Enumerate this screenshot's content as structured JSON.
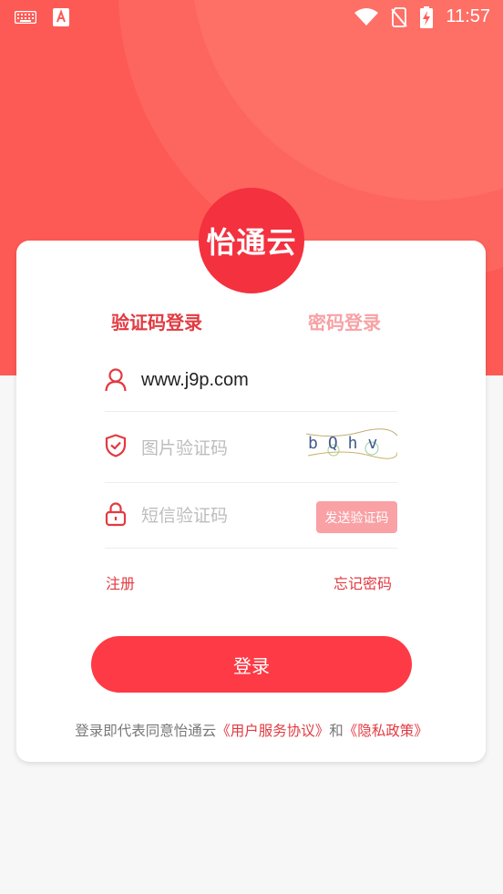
{
  "status_bar": {
    "time": "11:57",
    "icons": [
      "keyboard-icon",
      "app-a-icon",
      "wifi-icon",
      "no-sim-icon",
      "battery-charging-icon"
    ]
  },
  "colors": {
    "hero_bg": "#fe5a55",
    "accent": "#e23a41",
    "button": "#fd3a45",
    "sms_button": "#f9a1a5",
    "inactive_tab": "#f7a1a4"
  },
  "logo": {
    "text": "怡通云"
  },
  "tabs": [
    {
      "label": "验证码登录",
      "active": true
    },
    {
      "label": "密码登录",
      "active": false
    }
  ],
  "form": {
    "username": {
      "icon": "user-icon",
      "value": "www.j9p.com"
    },
    "image_code": {
      "icon": "shield-check-icon",
      "placeholder": "图片验证码",
      "captcha_text": "bQhv"
    },
    "sms_code": {
      "icon": "lock-icon",
      "placeholder": "短信验证码",
      "send_label": "发送验证码"
    }
  },
  "links": {
    "register": "注册",
    "forgot": "忘记密码"
  },
  "login_button": "登录",
  "agreement": {
    "prefix": "登录即代表同意怡通云",
    "terms": "《用户服务协议》",
    "and": "和",
    "privacy": "《隐私政策》"
  }
}
